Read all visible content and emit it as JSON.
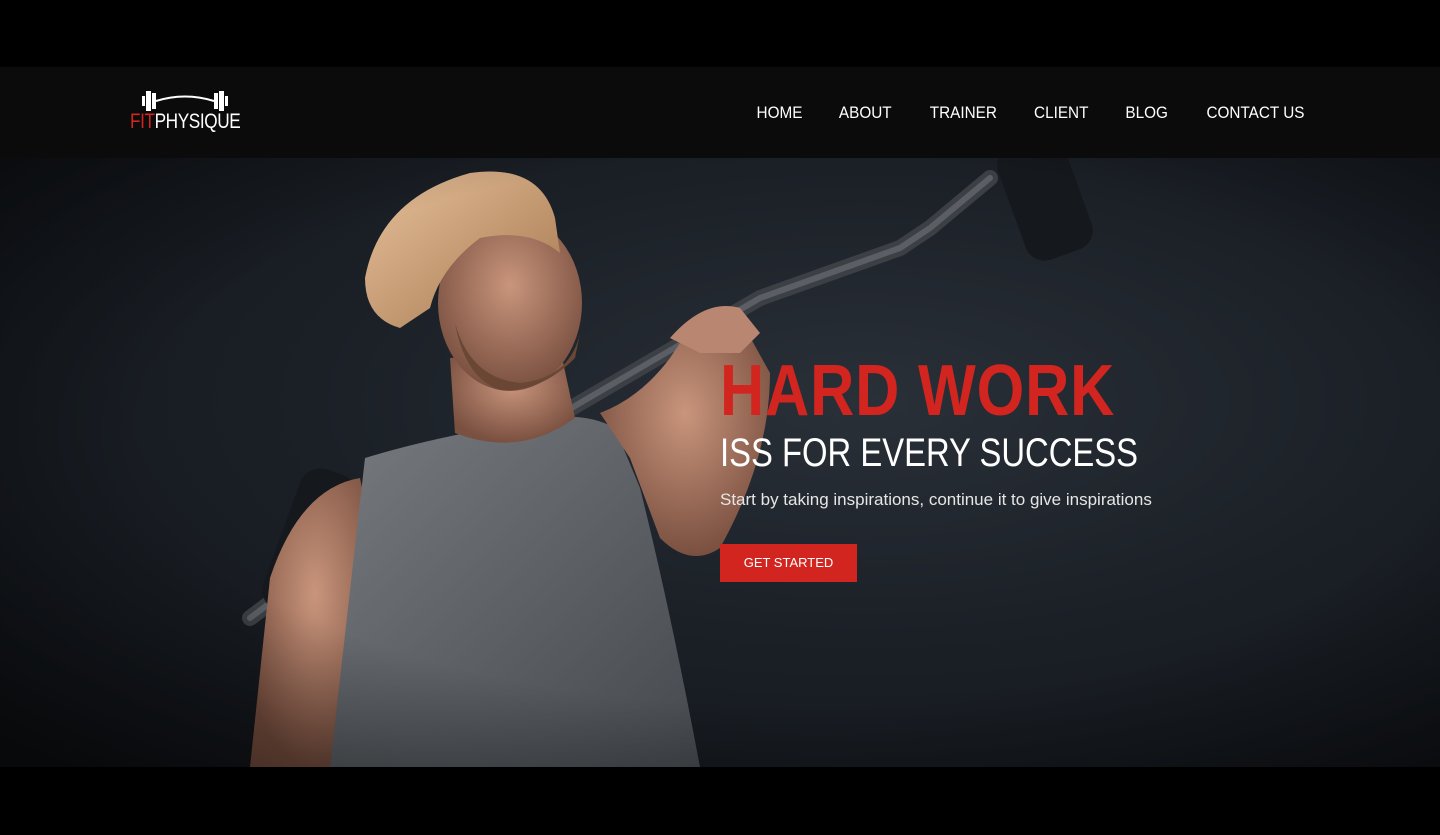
{
  "brand": {
    "logo_icon": "barbell-icon",
    "name_fit": "FIT",
    "name_rest": "PHYSIQUE",
    "accent_color": "#d2251f"
  },
  "nav": {
    "items": [
      "HOME",
      "ABOUT",
      "TRAINER",
      "CLIENT",
      "BLOG",
      "CONTACT US"
    ]
  },
  "hero": {
    "title": "HARD WORK",
    "subtitle": "ISS FOR EVERY SUCCESS",
    "description": "Start by taking inspirations, continue it to give inspirations",
    "cta_label": "GET STARTED"
  }
}
